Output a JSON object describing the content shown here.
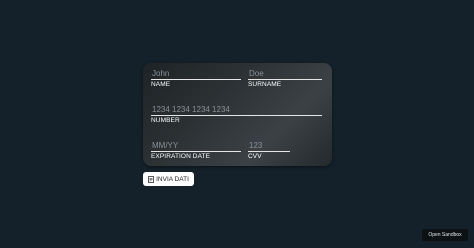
{
  "form": {
    "name": {
      "placeholder": "John",
      "label": "NAME"
    },
    "surname": {
      "placeholder": "Doe",
      "label": "SURNAME"
    },
    "number": {
      "placeholder": "1234 1234 1234 1234",
      "label": "NUMBER"
    },
    "expiration": {
      "placeholder": "MM/YY",
      "label": "EXPIRATION DATE"
    },
    "cvv": {
      "placeholder": "123",
      "label": "CVV"
    }
  },
  "submit": {
    "label": "INVIA DATI",
    "icon": "send-icon"
  },
  "sandbox": {
    "label": "Open Sandbox"
  },
  "colors": {
    "background": "#14212a",
    "card": "#2b3033",
    "placeholder": "#8a9196",
    "label": "#ffffff"
  }
}
